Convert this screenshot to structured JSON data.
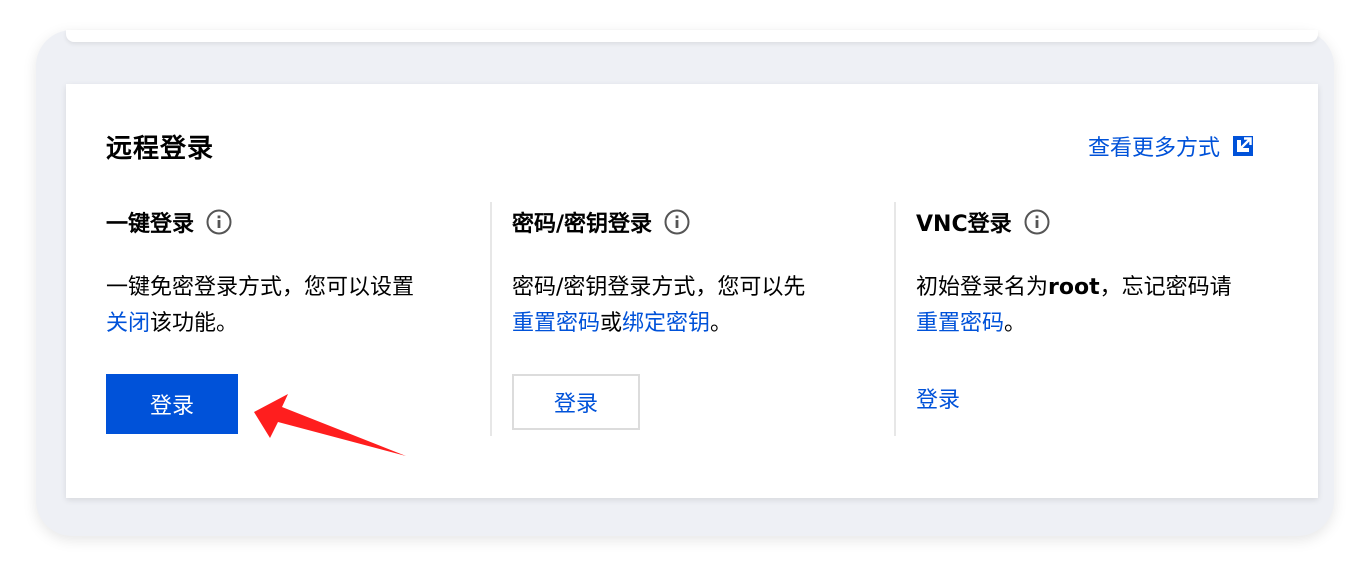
{
  "card": {
    "title": "远程登录",
    "more_link": "查看更多方式"
  },
  "columns": [
    {
      "heading": "一键登录",
      "desc_text": "一键免密登录方式，您可以设置",
      "desc_link": "关闭",
      "desc_tail": "该功能。",
      "button": "登录"
    },
    {
      "heading": "密码/密钥登录",
      "desc_text": "密码/密钥登录方式，您可以先",
      "link_reset": "重置密码",
      "or_text": "或",
      "link_bind": "绑定密钥",
      "desc_tail": "。",
      "button": "登录"
    },
    {
      "heading": "VNC登录",
      "desc_text": "初始登录名为",
      "desc_bold": "root",
      "desc_text2": "，忘记密码请",
      "link_reset": "重置密码",
      "desc_tail": "。",
      "button": "登录"
    }
  ],
  "icons": {
    "info": "info-circle-icon",
    "external": "external-link-icon",
    "annotation": "red-arrow"
  },
  "colors": {
    "brand": "#0052d9",
    "arrow": "#ff1e1e",
    "frame": "#eef0f5"
  }
}
